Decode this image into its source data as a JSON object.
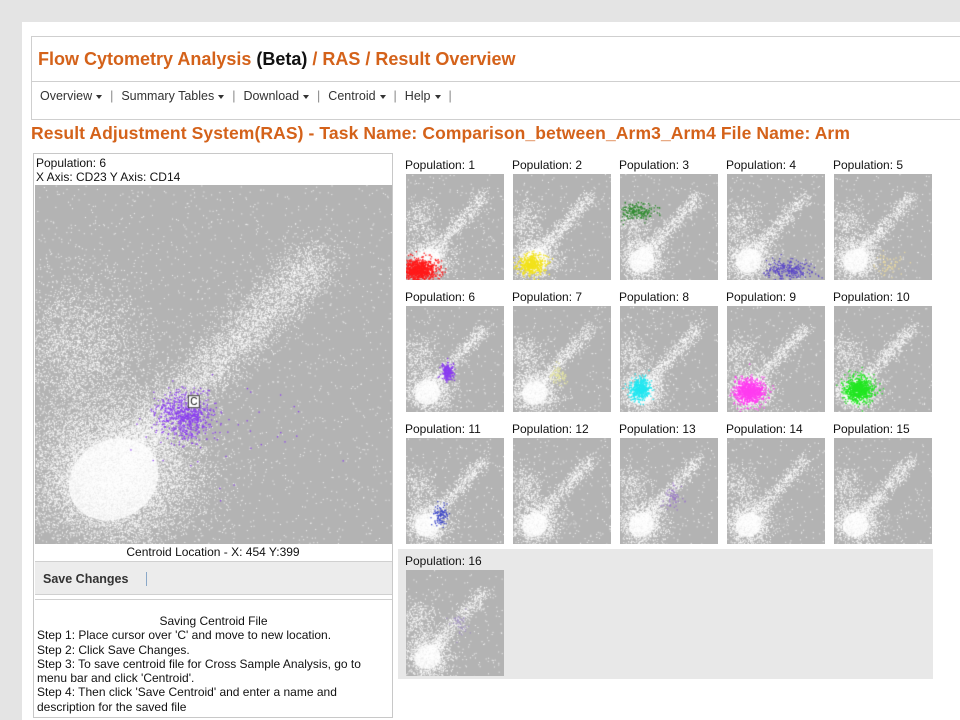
{
  "app": {
    "title_main": "Flow Cytometry Analysis ",
    "title_beta": "(Beta)",
    "title_path": " / RAS / Result Overview"
  },
  "menu": [
    {
      "label": "Overview"
    },
    {
      "label": "Summary Tables"
    },
    {
      "label": "Download"
    },
    {
      "label": "Centroid"
    },
    {
      "label": "Help"
    }
  ],
  "menu_separator": "|",
  "ras_title": "Result Adjustment System(RAS) - Task Name: Comparison_between_Arm3_Arm4   File Name: Arm",
  "selected_plot": {
    "population_label": "Population: 6",
    "axis_label": "X Axis: CD23   Y Axis: CD14",
    "centroid_marker": "C",
    "centroid_location": "Centroid Location - X: 454   Y:399",
    "cluster_color": "#8a3cf0"
  },
  "save_button": "Save Changes",
  "instructions": {
    "title": "Saving Centroid File",
    "steps": [
      "Step 1: Place cursor over 'C' and move to new location.",
      "Step 2: Click Save Changes.",
      "Step 3: To save centroid file for Cross Sample Analysis, go to menu bar and click 'Centroid'.",
      "Step 4: Then click 'Save Centroid' and enter a name and description for the saved file"
    ]
  },
  "populations": [
    {
      "label": "Population: 1",
      "color": "#ff1a1a"
    },
    {
      "label": "Population: 2",
      "color": "#f2e21a"
    },
    {
      "label": "Population: 3",
      "color": "#2e8b2e"
    },
    {
      "label": "Population: 4",
      "color": "#5a46c8"
    },
    {
      "label": "Population: 5",
      "color": "#e8d8a0"
    },
    {
      "label": "Population: 6",
      "color": "#8a3cf0"
    },
    {
      "label": "Population: 7",
      "color": "#e6e6a0"
    },
    {
      "label": "Population: 8",
      "color": "#22e6f0"
    },
    {
      "label": "Population: 9",
      "color": "#ff3cf0"
    },
    {
      "label": "Population: 10",
      "color": "#22e622"
    },
    {
      "label": "Population: 11",
      "color": "#3c46c8"
    },
    {
      "label": "Population: 12",
      "color": "#c8c8c8"
    },
    {
      "label": "Population: 13",
      "color": "#9a78c8"
    },
    {
      "label": "Population: 14",
      "color": "#c0c0c0"
    },
    {
      "label": "Population: 15",
      "color": "#c8c8c8"
    },
    {
      "label": "Population: 16",
      "color": "#a090c0"
    }
  ]
}
